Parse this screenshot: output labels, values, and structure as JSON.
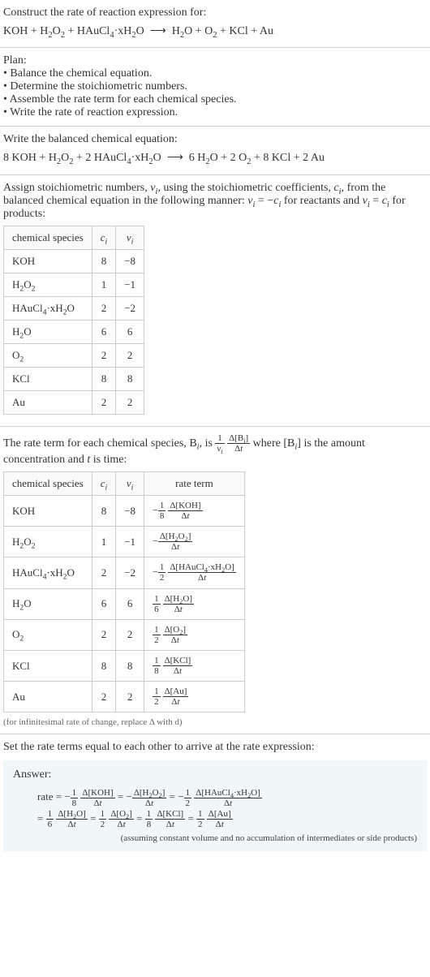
{
  "prompt": {
    "title": "Construct the rate of reaction expression for:",
    "equation_html": "KOH + H<span class='sub'>2</span>O<span class='sub'>2</span> + HAuCl<span class='sub'>4</span>·xH<span class='sub'>2</span>O &nbsp;⟶&nbsp; H<span class='sub'>2</span>O + O<span class='sub'>2</span> + KCl + Au"
  },
  "plan": {
    "title": "Plan:",
    "items": [
      "Balance the chemical equation.",
      "Determine the stoichiometric numbers.",
      "Assemble the rate term for each chemical species.",
      "Write the rate of reaction expression."
    ]
  },
  "balanced": {
    "title": "Write the balanced chemical equation:",
    "equation_html": "8 KOH + H<span class='sub'>2</span>O<span class='sub'>2</span> + 2 HAuCl<span class='sub'>4</span>·xH<span class='sub'>2</span>O &nbsp;⟶&nbsp; 6 H<span class='sub'>2</span>O + 2 O<span class='sub'>2</span> + 8 KCl + 2 Au"
  },
  "stoich_intro_html": "Assign stoichiometric numbers, <span class='inline-math'>ν<span class='sub'>i</span></span>, using the stoichiometric coefficients, <span class='inline-math'>c<span class='sub'>i</span></span>, from the balanced chemical equation in the following manner: <span class='inline-math'>ν<span class='sub'>i</span></span> = −<span class='inline-math'>c<span class='sub'>i</span></span> for reactants and <span class='inline-math'>ν<span class='sub'>i</span></span> = <span class='inline-math'>c<span class='sub'>i</span></span> for products:",
  "table1": {
    "headers": [
      "chemical species",
      "c_i",
      "ν_i"
    ],
    "rows": [
      {
        "species_html": "KOH",
        "c": "8",
        "v": "−8"
      },
      {
        "species_html": "H<span class='sub'>2</span>O<span class='sub'>2</span>",
        "c": "1",
        "v": "−1"
      },
      {
        "species_html": "HAuCl<span class='sub'>4</span>·xH<span class='sub'>2</span>O",
        "c": "2",
        "v": "−2"
      },
      {
        "species_html": "H<span class='sub'>2</span>O",
        "c": "6",
        "v": "6"
      },
      {
        "species_html": "O<span class='sub'>2</span>",
        "c": "2",
        "v": "2"
      },
      {
        "species_html": "KCl",
        "c": "8",
        "v": "8"
      },
      {
        "species_html": "Au",
        "c": "2",
        "v": "2"
      }
    ]
  },
  "rate_term_intro_html": "The rate term for each chemical species, B<span class='sub'><i>i</i></span>, is <span class='frac'><span class='num'>1</span><span class='den'><i>ν<span class='sub'>i</span></i></span></span> <span class='frac'><span class='num'>Δ[B<span class='sub'><i>i</i></span>]</span><span class='den'>Δ<i>t</i></span></span> where [B<span class='sub'><i>i</i></span>] is the amount concentration and <i>t</i> is time:",
  "table2": {
    "headers": [
      "chemical species",
      "c_i",
      "ν_i",
      "rate term"
    ],
    "rows": [
      {
        "species_html": "KOH",
        "c": "8",
        "v": "−8",
        "rate_html": "−<span class='frac'><span class='num'>1</span><span class='den'>8</span></span> <span class='frac'><span class='num'>Δ[KOH]</span><span class='den'>Δ<i>t</i></span></span>"
      },
      {
        "species_html": "H<span class='sub'>2</span>O<span class='sub'>2</span>",
        "c": "1",
        "v": "−1",
        "rate_html": "−<span class='frac'><span class='num'>Δ[H<span class='sub'>2</span>O<span class='sub'>2</span>]</span><span class='den'>Δ<i>t</i></span></span>"
      },
      {
        "species_html": "HAuCl<span class='sub'>4</span>·xH<span class='sub'>2</span>O",
        "c": "2",
        "v": "−2",
        "rate_html": "−<span class='frac'><span class='num'>1</span><span class='den'>2</span></span> <span class='frac'><span class='num'>Δ[HAuCl<span class='sub'>4</span>·xH<span class='sub'>2</span>O]</span><span class='den'>Δ<i>t</i></span></span>"
      },
      {
        "species_html": "H<span class='sub'>2</span>O",
        "c": "6",
        "v": "6",
        "rate_html": "<span class='frac'><span class='num'>1</span><span class='den'>6</span></span> <span class='frac'><span class='num'>Δ[H<span class='sub'>2</span>O]</span><span class='den'>Δ<i>t</i></span></span>"
      },
      {
        "species_html": "O<span class='sub'>2</span>",
        "c": "2",
        "v": "2",
        "rate_html": "<span class='frac'><span class='num'>1</span><span class='den'>2</span></span> <span class='frac'><span class='num'>Δ[O<span class='sub'>2</span>]</span><span class='den'>Δ<i>t</i></span></span>"
      },
      {
        "species_html": "KCl",
        "c": "8",
        "v": "8",
        "rate_html": "<span class='frac'><span class='num'>1</span><span class='den'>8</span></span> <span class='frac'><span class='num'>Δ[KCl]</span><span class='den'>Δ<i>t</i></span></span>"
      },
      {
        "species_html": "Au",
        "c": "2",
        "v": "2",
        "rate_html": "<span class='frac'><span class='num'>1</span><span class='den'>2</span></span> <span class='frac'><span class='num'>Δ[Au]</span><span class='den'>Δ<i>t</i></span></span>"
      }
    ]
  },
  "infinitesimal_note": "(for infinitesimal rate of change, replace Δ with d)",
  "final_intro": "Set the rate terms equal to each other to arrive at the rate expression:",
  "answer": {
    "label": "Answer:",
    "line1_html": "rate = −<span class='frac'><span class='num'>1</span><span class='den'>8</span></span> <span class='frac'><span class='num'>Δ[KOH]</span><span class='den'>Δ<i>t</i></span></span> = −<span class='frac'><span class='num'>Δ[H<span class='sub'>2</span>O<span class='sub'>2</span>]</span><span class='den'>Δ<i>t</i></span></span> = −<span class='frac'><span class='num'>1</span><span class='den'>2</span></span> <span class='frac'><span class='num'>Δ[HAuCl<span class='sub'>4</span>·xH<span class='sub'>2</span>O]</span><span class='den'>Δ<i>t</i></span></span>",
    "line2_html": "= <span class='frac'><span class='num'>1</span><span class='den'>6</span></span> <span class='frac'><span class='num'>Δ[H<span class='sub'>2</span>O]</span><span class='den'>Δ<i>t</i></span></span> = <span class='frac'><span class='num'>1</span><span class='den'>2</span></span> <span class='frac'><span class='num'>Δ[O<span class='sub'>2</span>]</span><span class='den'>Δ<i>t</i></span></span> = <span class='frac'><span class='num'>1</span><span class='den'>8</span></span> <span class='frac'><span class='num'>Δ[KCl]</span><span class='den'>Δ<i>t</i></span></span> = <span class='frac'><span class='num'>1</span><span class='den'>2</span></span> <span class='frac'><span class='num'>Δ[Au]</span><span class='den'>Δ<i>t</i></span></span>",
    "note": "(assuming constant volume and no accumulation of intermediates or side products)"
  },
  "math_headers": {
    "ci_html": "<i>c<span class='sub'>i</span></i>",
    "vi_html": "<i>ν<span class='sub'>i</span></i>"
  }
}
